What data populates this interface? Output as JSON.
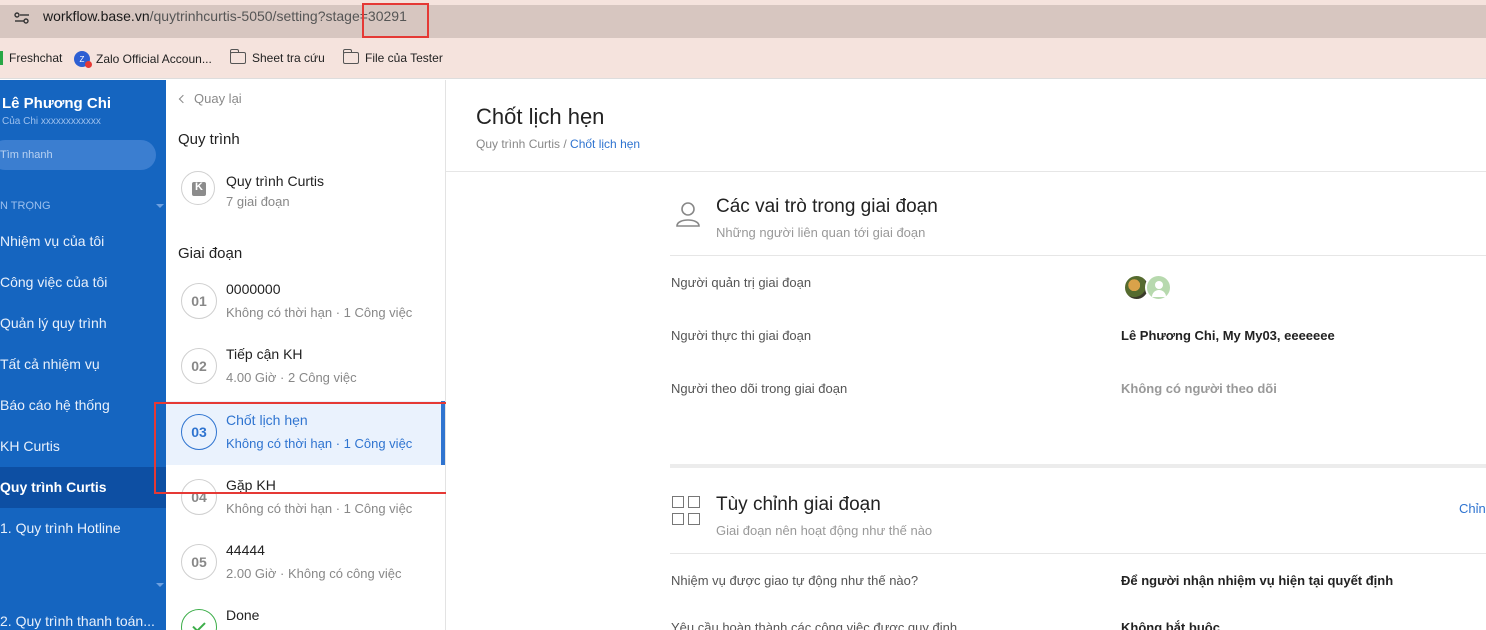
{
  "browser": {
    "url_host": "workflow.base.vn",
    "url_path": "/quytrinhcurtis-5050/setting?stage",
    "url_eq": "=",
    "url_stage": "30291"
  },
  "bookmarks": [
    {
      "label": "Freshchat",
      "icon": "freshchat-icon"
    },
    {
      "label": "Zalo Official Accoun...",
      "icon": "zalo-icon"
    },
    {
      "label": "Sheet tra cứu",
      "icon": "folder-icon"
    },
    {
      "label": "File của Tester",
      "icon": "folder-icon"
    }
  ],
  "sidebar": {
    "user_name": "Lê Phương Chi",
    "user_sub": "Của Chi xxxxxxxxxxxx",
    "search_placeholder": "Tìm nhanh",
    "section_label": "N TRỌNG",
    "items": [
      {
        "label": "Nhiệm vụ của tôi"
      },
      {
        "label": "Công việc của tôi"
      },
      {
        "label": "Quản lý quy trình"
      },
      {
        "label": "Tất cả nhiệm vụ"
      },
      {
        "label": "Báo cáo hệ thống"
      },
      {
        "label": "KH Curtis"
      },
      {
        "label": "Quy trình Curtis",
        "active": true
      },
      {
        "label": "1. Quy trình Hotline"
      },
      {
        "label": "2. Quy trình thanh toán..."
      }
    ]
  },
  "mid": {
    "back_label": "Quay lại",
    "workflow_heading": "Quy trình",
    "workflow_title": "Quy trình Curtis",
    "workflow_sub": "7 giai đoạn",
    "stages_heading": "Giai đoạn",
    "stages": [
      {
        "num": "01",
        "title": "0000000",
        "sub": "Không có thời hạn · 1 Công việc"
      },
      {
        "num": "02",
        "title": "Tiếp cận KH",
        "sub": "4.00 Giờ · 2 Công việc"
      },
      {
        "num": "03",
        "title": "Chốt lịch hẹn",
        "sub": "Không có thời hạn · 1 Công việc",
        "active": true
      },
      {
        "num": "04",
        "title": "Gặp KH",
        "sub": "Không có thời hạn · 1 Công việc"
      },
      {
        "num": "05",
        "title": "44444",
        "sub": "2.00 Giờ · Không có công việc"
      },
      {
        "num": "",
        "title": "Done",
        "sub": "",
        "done": true
      }
    ]
  },
  "main": {
    "page_title": "Chốt lịch hẹn",
    "breadcrumb_root": "Quy trình Curtis",
    "breadcrumb_sep": " / ",
    "breadcrumb_current": "Chốt lịch hẹn",
    "roles": {
      "title": "Các vai trò trong giai đoạn",
      "subtitle": "Những người liên quan tới giai đoạn",
      "rows": [
        {
          "label": "Người quản trị giai đoạn",
          "value": ""
        },
        {
          "label": "Người thực thi giai đoạn",
          "value": "Lê Phương Chi, My My03, eeeeeee"
        },
        {
          "label": "Người theo dõi trong giai đoạn",
          "value": "Không có người theo dõi"
        }
      ]
    },
    "customize": {
      "title": "Tùy chỉnh giai đoạn",
      "subtitle": "Giai đoạn nên hoạt động như thế nào",
      "edit_label": "Chỉn",
      "rows": [
        {
          "label": "Nhiệm vụ được giao tự động như thế nào?",
          "value": "Để người nhận nhiệm vụ hiện tại quyết định"
        },
        {
          "label": "Yêu cầu hoàn thành các công việc được quy định",
          "value": "Không bắt buộc"
        }
      ]
    }
  },
  "colors": {
    "sidebar_bg": "#1565c0",
    "accent": "#2f74d0",
    "highlight": "#e53935",
    "done": "#3dae4a"
  }
}
